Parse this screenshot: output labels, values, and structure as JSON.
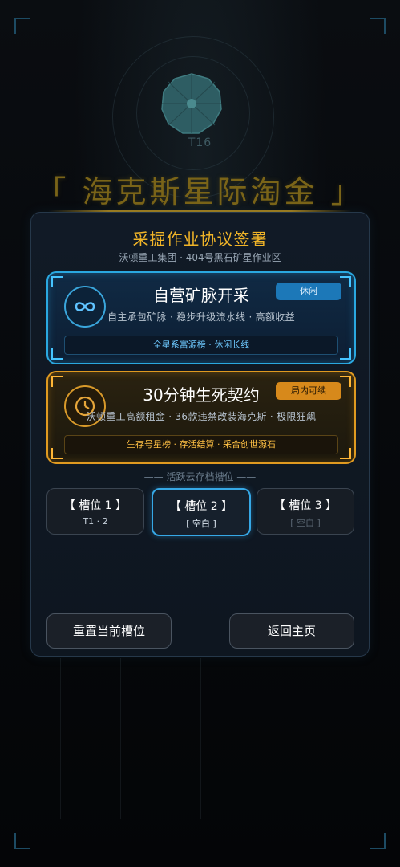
{
  "emblem": {
    "code": "T16"
  },
  "game_title": "「 海克斯星际淘金 」",
  "panel": {
    "title": "采掘作业协议签署",
    "subtitle": "沃顿重工集团 · 404号黑石矿星作业区"
  },
  "modes": [
    {
      "name": "自营矿脉开采",
      "tag": "休闲",
      "features": "自主承包矿脉 · 稳步升级流水线 · 高额收益",
      "strip": "全星系富源榜 · 休闲长线",
      "icon": "infinity-icon"
    },
    {
      "name": "30分钟生死契约",
      "tag": "局内可续",
      "features": "沃顿重工高额租金 · 36款违禁改装海克斯 · 极限狂飙",
      "strip": "生存号星榜 · 存活结算 · 采合创世源石",
      "icon": "clock-icon"
    }
  ],
  "slots": {
    "header": "—— 活跃云存档槽位 ——",
    "items": [
      {
        "label": "【 槽位 1 】",
        "info": "T1 · 2",
        "state": "used"
      },
      {
        "label": "【 槽位 2 】",
        "info": "[ 空白 ]",
        "state": "active"
      },
      {
        "label": "【 槽位 3 】",
        "info": "[ 空白 ]",
        "state": "empty"
      }
    ]
  },
  "buttons": {
    "reset": "重置当前槽位",
    "home": "返回主页"
  },
  "colors": {
    "gold": "#f0b428",
    "blue": "#2aa8e0",
    "panel": "#111a26"
  }
}
